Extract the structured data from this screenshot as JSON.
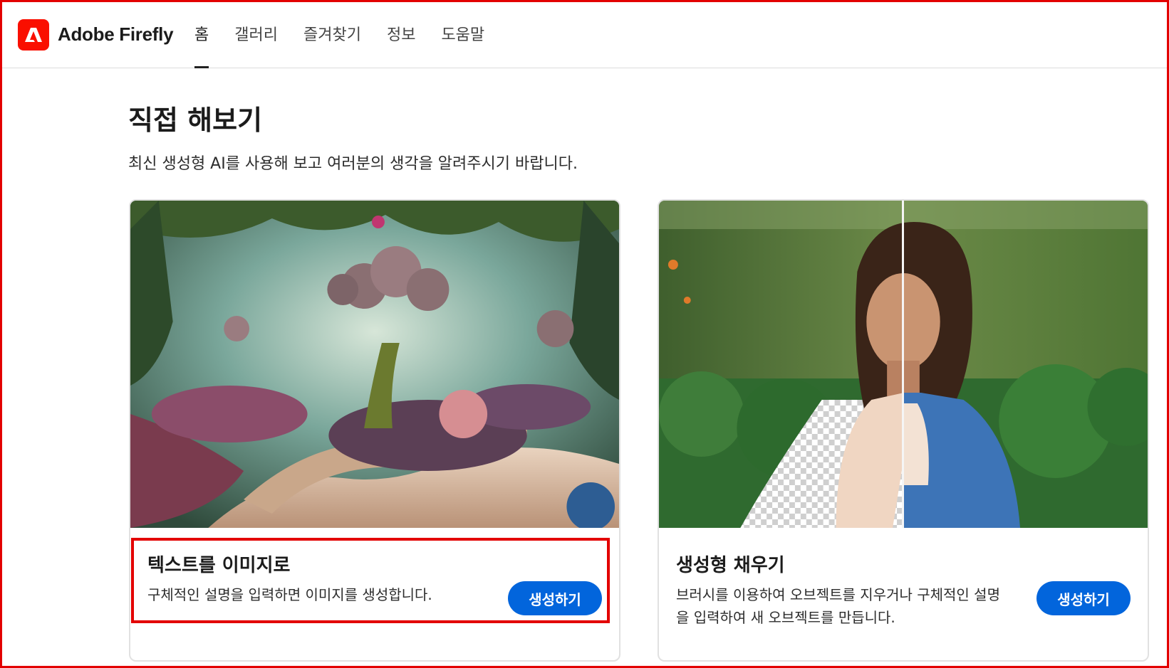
{
  "header": {
    "brand": "Adobe Firefly",
    "nav": [
      "홈",
      "갤러리",
      "즐겨찾기",
      "정보",
      "도움말"
    ],
    "active_index": 0
  },
  "main": {
    "title": "직접 해보기",
    "subtitle": "최신 생성형 AI를 사용해 보고 여러분의 생각을 알려주시기 바랍니다."
  },
  "cards": [
    {
      "title": "텍스트를 이미지로",
      "description": "구체적인 설명을 입력하면 이미지를 생성합니다.",
      "button": "생성하기",
      "image": "fantasy-garden-image"
    },
    {
      "title": "생성형 채우기",
      "description": "브러시를 이용하여 오브젝트를 지우거나 구체적인 설명을 입력하여 새 오브젝트를 만듭니다.",
      "button": "생성하기",
      "image": "woman-portrait-fill-image"
    }
  ],
  "colors": {
    "accent": "#0265dc",
    "brand": "#fa0f00",
    "highlight": "#e30000"
  }
}
